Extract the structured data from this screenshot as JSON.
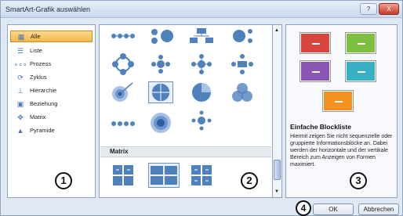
{
  "window": {
    "title": "SmartArt-Grafik auswählen",
    "help_label": "?",
    "close_label": "X"
  },
  "categories": [
    {
      "label": "Alle",
      "icon": "grid-icon"
    },
    {
      "label": "Liste",
      "icon": "list-icon"
    },
    {
      "label": "Prozess",
      "icon": "process-icon"
    },
    {
      "label": "Zyklus",
      "icon": "cycle-icon"
    },
    {
      "label": "Hierarchie",
      "icon": "hierarchy-icon"
    },
    {
      "label": "Beziehung",
      "icon": "relationship-icon"
    },
    {
      "label": "Matrix",
      "icon": "matrix-icon"
    },
    {
      "label": "Pyramide",
      "icon": "pyramid-icon"
    }
  ],
  "gallery": {
    "section_label": "Matrix"
  },
  "preview": {
    "title": "Einfache Blockliste",
    "description": "Hiermit zeigen Sie nicht sequenzielle oder gruppierte Informationsblöcke an. Dabei werden der horizontale und der vertikale Bereich zum Anzeigen von Formen maximiert.",
    "block_colors": [
      "#d9463d",
      "#7fbf3f",
      "#8a55b5",
      "#36b0c2",
      "#f5911e"
    ]
  },
  "callouts": {
    "one": "1",
    "two": "2",
    "three": "3",
    "four": "4"
  },
  "buttons": {
    "ok": "OK",
    "cancel": "Abbrechen"
  }
}
